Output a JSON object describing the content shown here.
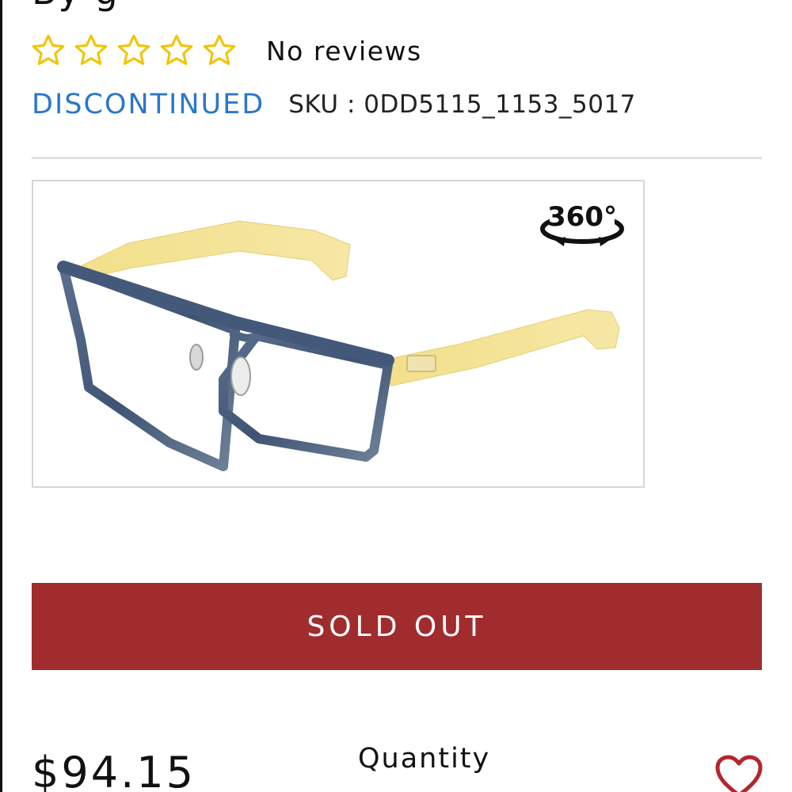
{
  "product": {
    "title_fragment": "By g",
    "reviews_text": "No reviews",
    "rating_stars": 0,
    "status": "DISCONTINUED",
    "sku_label": "SKU : 0DD5115_1153_5017",
    "viewer_badge": "360°",
    "price": "$94.15"
  },
  "actions": {
    "sold_out_label": "SOLD OUT",
    "quantity_label": "Quantity"
  },
  "icons": {
    "star": "star-outline-icon",
    "rotate": "rotate-360-icon",
    "wishlist": "heart-outline-icon"
  },
  "colors": {
    "star": "#f2c400",
    "status": "#2a78c8",
    "sold_out_bg": "#a02c2e",
    "heart": "#b3262d"
  }
}
